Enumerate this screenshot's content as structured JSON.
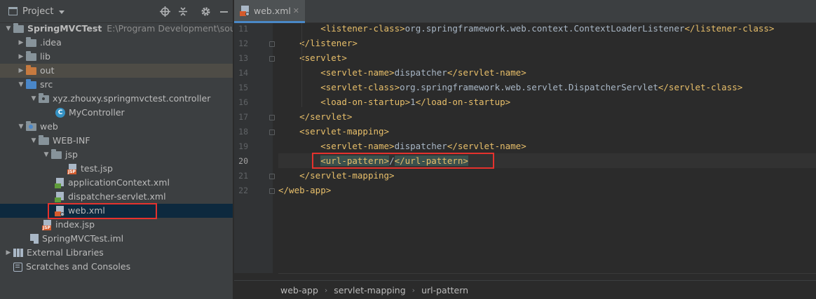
{
  "project_panel": {
    "title": "Project",
    "tools": {
      "locate_icon": "target-icon",
      "collapse_icon": "collapse-icon",
      "settings_icon": "gear-icon",
      "hide_icon": "minimize-icon"
    }
  },
  "tree": {
    "root": {
      "label": "SpringMVCTest",
      "path": "E:\\Program Development\\source"
    },
    "idea": ".idea",
    "lib": "lib",
    "out": "out",
    "src": "src",
    "package": "xyz.zhouxy.springmvctest.controller",
    "controller": {
      "label": "MyController",
      "badge": "C"
    },
    "web": "web",
    "webinf": "WEB-INF",
    "jsp_folder": "jsp",
    "test_jsp": "test.jsp",
    "app_context": "applicationContext.xml",
    "dispatcher": "dispatcher-servlet.xml",
    "web_xml": "web.xml",
    "index_jsp": "index.jsp",
    "iml": "SpringMVCTest.iml",
    "external_libraries": "External Libraries",
    "scratches": "Scratches and Consoles",
    "jsp_badge": "JSP"
  },
  "editor": {
    "tab": {
      "label": "web.xml",
      "close": "✕"
    },
    "lines": [
      {
        "num": "11",
        "indent": "        ",
        "open": "<listener-class>",
        "text": "org.springframework.web.context.ContextLoaderListener",
        "close": "</listener-class>"
      },
      {
        "num": "12",
        "indent": "    ",
        "open": "</listener>",
        "text": "",
        "close": ""
      },
      {
        "num": "13",
        "indent": "    ",
        "open": "<servlet>",
        "text": "",
        "close": ""
      },
      {
        "num": "14",
        "indent": "        ",
        "open": "<servlet-name>",
        "text": "dispatcher",
        "close": "</servlet-name>"
      },
      {
        "num": "15",
        "indent": "        ",
        "open": "<servlet-class>",
        "text": "org.springframework.web.servlet.DispatcherServlet",
        "close": "</servlet-class>"
      },
      {
        "num": "16",
        "indent": "        ",
        "open": "<load-on-startup>",
        "text": "1",
        "close": "</load-on-startup>"
      },
      {
        "num": "17",
        "indent": "    ",
        "open": "</servlet>",
        "text": "",
        "close": ""
      },
      {
        "num": "18",
        "indent": "    ",
        "open": "<servlet-mapping>",
        "text": "",
        "close": ""
      },
      {
        "num": "19",
        "indent": "        ",
        "open": "<servlet-name>",
        "text": "dispatcher",
        "close": "</servlet-name>"
      },
      {
        "num": "20",
        "indent": "        ",
        "open": "<url-pattern>",
        "text": "/",
        "close": "</url-pattern>"
      },
      {
        "num": "21",
        "indent": "    ",
        "open": "</servlet-mapping>",
        "text": "",
        "close": ""
      },
      {
        "num": "22",
        "indent": "",
        "open": "</web-app>",
        "text": "",
        "close": ""
      }
    ],
    "current_line": "20"
  },
  "breadcrumbs": [
    "web-app",
    "servlet-mapping",
    "url-pattern"
  ],
  "colors": {
    "tag": "#e8bf6a",
    "text": "#a9b7c6",
    "highlight_box": "#e5322d",
    "selection": "#0d293e"
  }
}
